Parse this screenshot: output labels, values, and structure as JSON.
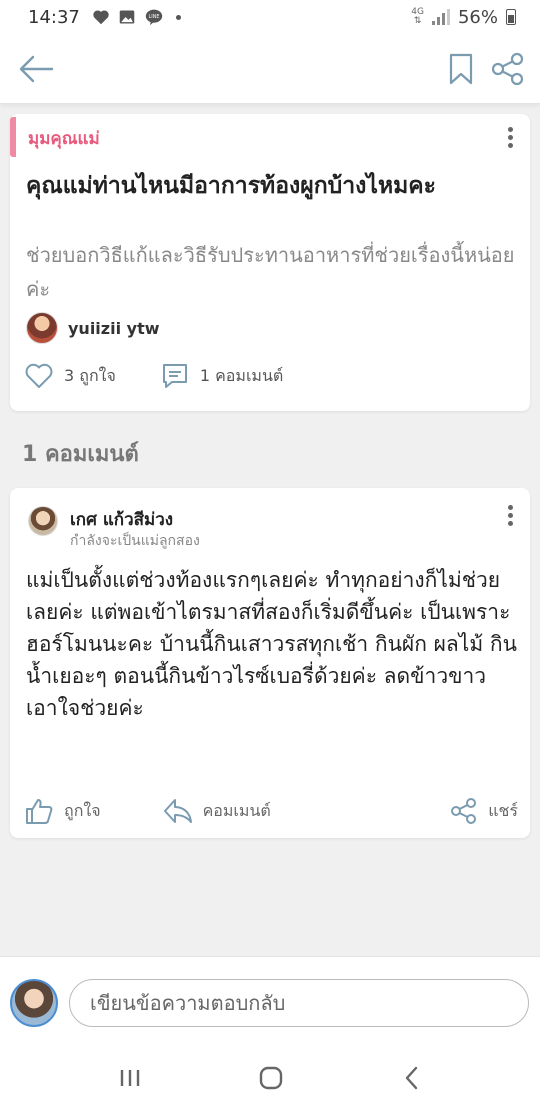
{
  "status_bar": {
    "time": "14:37",
    "network": "4G",
    "battery": "56%"
  },
  "post": {
    "category": "มุมคุณแม่",
    "title": "คุณแม่ท่านไหนมีอาการท้องผูกบ้างไหมคะ",
    "description": "ช่วยบอกวิธีแก้และวิธีรับประทานอาหารที่ช่วยเรื่องนี้หน่อยค่ะ",
    "author": "yuiizii ytw",
    "likes_label": "3 ถูกใจ",
    "comments_label": "1 คอมเมนต์"
  },
  "comments_header": "1 คอมเมนต์",
  "comment": {
    "name": "เกศ แก้วสีม่วง",
    "subtitle": "กำลังจะเป็นแม่ลูกสอง",
    "body": "แม่เป็นตั้งแต่ช่วงท้องแรกๆเลยค่ะ ทำทุกอย่างก็ไม่ช่วยเลยค่ะ แต่พอเข้าไตรมาสที่สองก็เริ่มดีขึ้นค่ะ เป็นเพราะฮอร์โมนนะคะ บ้านนี้กินเสาวรสทุกเช้า กินผัก ผลไม้ กินน้ำเยอะๆ ตอนนี้กินข้าวไรซ์เบอรี่ด้วยค่ะ ลดข้าวขาว เอาใจช่วยค่ะ",
    "like_label": "ถูกใจ",
    "comment_label": "คอมเมนต์",
    "share_label": "แชร์"
  },
  "reply": {
    "placeholder": "เขียนข้อความตอบกลับ"
  },
  "colors": {
    "category_accent": "#e85a7e",
    "category_bar": "#f08aa2",
    "avatar_ring": "#4c8ed3"
  }
}
